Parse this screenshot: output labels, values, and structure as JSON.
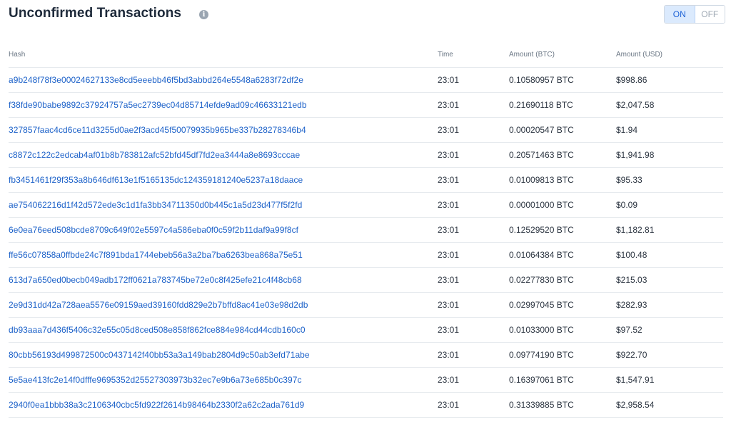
{
  "header": {
    "title": "Unconfirmed Transactions",
    "info_icon": "i",
    "toggle": {
      "on_label": "ON",
      "off_label": "OFF",
      "selected": "ON"
    }
  },
  "colors": {
    "link": "#1d62c9",
    "toggle_active_bg": "#dbeafd",
    "toggle_active_text": "#1f63d6"
  },
  "table": {
    "headers": {
      "hash": "Hash",
      "time": "Time",
      "amount_btc": "Amount (BTC)",
      "amount_usd": "Amount (USD)"
    },
    "rows": [
      {
        "hash": "a9b248f78f3e00024627133e8cd5eeebb46f5bd3abbd264e5548a6283f72df2e",
        "time": "23:01",
        "btc": "0.10580957 BTC",
        "usd": "$998.86"
      },
      {
        "hash": "f38fde90babe9892c37924757a5ec2739ec04d85714efde9ad09c46633121edb",
        "time": "23:01",
        "btc": "0.21690118 BTC",
        "usd": "$2,047.58"
      },
      {
        "hash": "327857faac4cd6ce11d3255d0ae2f3acd45f50079935b965be337b28278346b4",
        "time": "23:01",
        "btc": "0.00020547 BTC",
        "usd": "$1.94"
      },
      {
        "hash": "c8872c122c2edcab4af01b8b783812afc52bfd45df7fd2ea3444a8e8693cccae",
        "time": "23:01",
        "btc": "0.20571463 BTC",
        "usd": "$1,941.98"
      },
      {
        "hash": "fb3451461f29f353a8b646df613e1f5165135dc124359181240e5237a18daace",
        "time": "23:01",
        "btc": "0.01009813 BTC",
        "usd": "$95.33"
      },
      {
        "hash": "ae754062216d1f42d572ede3c1d1fa3bb34711350d0b445c1a5d23d477f5f2fd",
        "time": "23:01",
        "btc": "0.00001000 BTC",
        "usd": "$0.09"
      },
      {
        "hash": "6e0ea76eed508bcde8709c649f02e5597c4a586eba0f0c59f2b11daf9a99f8cf",
        "time": "23:01",
        "btc": "0.12529520 BTC",
        "usd": "$1,182.81"
      },
      {
        "hash": "ffe56c07858a0ffbde24c7f891bda1744ebeb56a3a2ba7ba6263bea868a75e51",
        "time": "23:01",
        "btc": "0.01064384 BTC",
        "usd": "$100.48"
      },
      {
        "hash": "613d7a650ed0becb049adb172ff0621a783745be72e0c8f425efe21c4f48cb68",
        "time": "23:01",
        "btc": "0.02277830 BTC",
        "usd": "$215.03"
      },
      {
        "hash": "2e9d31dd42a728aea5576e09159aed39160fdd829e2b7bffd8ac41e03e98d2db",
        "time": "23:01",
        "btc": "0.02997045 BTC",
        "usd": "$282.93"
      },
      {
        "hash": "db93aaa7d436f5406c32e55c05d8ced508e858f862fce884e984cd44cdb160c0",
        "time": "23:01",
        "btc": "0.01033000 BTC",
        "usd": "$97.52"
      },
      {
        "hash": "80cbb56193d499872500c0437142f40bb53a3a149bab2804d9c50ab3efd71abe",
        "time": "23:01",
        "btc": "0.09774190 BTC",
        "usd": "$922.70"
      },
      {
        "hash": "5e5ae413fc2e14f0dfffe9695352d25527303973b32ec7e9b6a73e685b0c397c",
        "time": "23:01",
        "btc": "0.16397061 BTC",
        "usd": "$1,547.91"
      },
      {
        "hash": "2940f0ea1bbb38a3c2106340cbc5fd922f2614b98464b2330f2a62c2ada761d9",
        "time": "23:01",
        "btc": "0.31339885 BTC",
        "usd": "$2,958.54"
      }
    ]
  }
}
